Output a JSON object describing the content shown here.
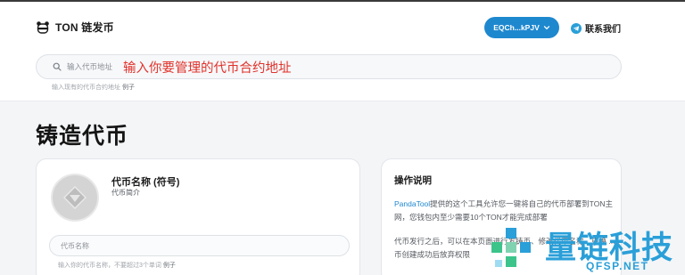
{
  "header": {
    "brand": "TON 链发币",
    "wallet_label": "EQCh...kPJV",
    "contact_label": "联系我们"
  },
  "search": {
    "placeholder": "输入代币地址",
    "hint_overlay": "输入你要管理的代币合约地址",
    "help_text": "输入现有的代币合约地址",
    "example_label": "例子"
  },
  "page": {
    "title": "铸造代币"
  },
  "token_form": {
    "title": "代币名称 (符号)",
    "description": "代币简介",
    "name_placeholder": "代币名称",
    "name_help": "输入你的代币名称，不要超过3个单词",
    "example_label": "例子"
  },
  "instructions": {
    "title": "操作说明",
    "p1_link": "PandaTool",
    "p1_text": "提供的这个工具允许您一键将自己的代币部署到TON主网，您钱包内至少需要10个TON才能完成部署",
    "p2_text": "代币发行之后，可以在本页面进行发铸币、修改代币名称、更换 ... 币创建成功后放弃权限"
  },
  "watermark": {
    "text": "量链科技",
    "sub": "QFSP.NET"
  },
  "colors": {
    "accent": "#1e88cf",
    "hint_red": "#e0322b",
    "watermark": "#2a9fd8",
    "watermark_green": "#3cc48a"
  }
}
